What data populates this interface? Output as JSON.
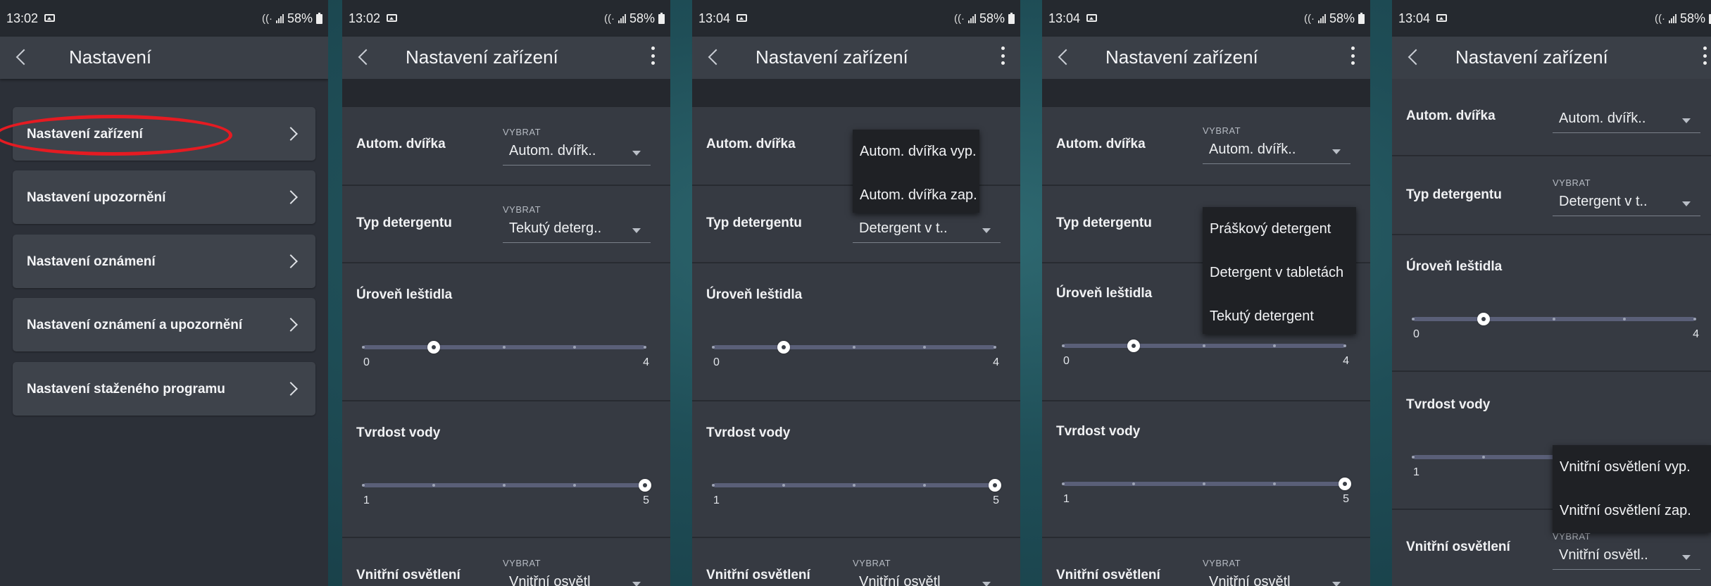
{
  "status": {
    "battery": "58%"
  },
  "colors": {
    "highlight": "#e51b22",
    "background": "#2c3038"
  },
  "panels": [
    {
      "time": "13:02",
      "title": "Nastavení",
      "menu": [
        "Nastavení zařízení",
        "Nastavení upozornění",
        "Nastavení oznámení",
        "Nastavení oznámení a upozornění",
        "Nastavení staženého programu"
      ]
    },
    {
      "time": "13:02",
      "title": "Nastavení zařízení"
    },
    {
      "time": "13:04",
      "title": "Nastavení zařízení"
    },
    {
      "time": "13:04",
      "title": "Nastavení zařízení"
    },
    {
      "time": "13:04",
      "title": "Nastavení zařízení"
    }
  ],
  "settings": {
    "door_label": "Autom. dvířka",
    "detergent_label": "Typ detergentu",
    "rinse_label": "Úroveň leštidla",
    "hardness_label": "Tvrdost vody",
    "light_label": "Vnitřní osvětlení",
    "select_caption": "VYBRAT",
    "door_value": "Autom. dvířk..",
    "detergent_value_liquid": "Tekutý deterg..",
    "detergent_value_tablet": "Detergent v t..",
    "light_value": "Vnitřní osvětl..",
    "light_value_cut": "Vnitřní osvětl",
    "rinse_min": "0",
    "rinse_max": "4",
    "rinse_level": 1,
    "hardness_min": "1",
    "hardness_max": "5",
    "hardness_level": 5
  },
  "popups": {
    "door_options": [
      "Autom. dvířka vyp.",
      "Autom. dvířka zap."
    ],
    "detergent_options": [
      "Práškový detergent",
      "Detergent v tabletách",
      "Tekutý detergent"
    ],
    "light_options": [
      "Vnitřní osvětlení vyp.",
      "Vnitřní osvětlení zap."
    ]
  }
}
